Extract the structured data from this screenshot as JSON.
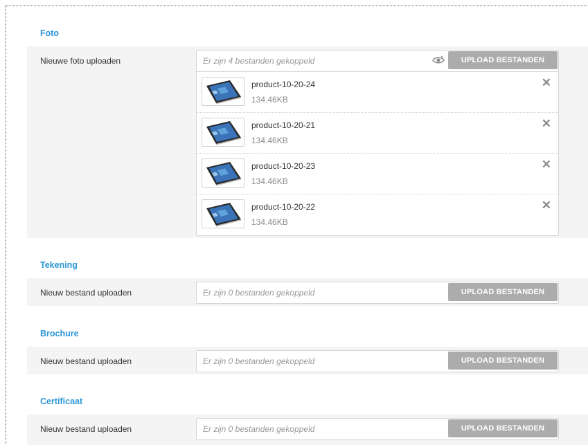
{
  "sections": {
    "foto": {
      "title": "Foto",
      "label": "Nieuwe foto uploaden",
      "placeholder": "Er zijn 4 bestanden gekoppeld",
      "button": "UPLOAD BESTANDEN",
      "files": [
        {
          "name": "product-10-20-24",
          "size": "134.46KB"
        },
        {
          "name": "product-10-20-21",
          "size": "134.46KB"
        },
        {
          "name": "product-10-20-23",
          "size": "134.46KB"
        },
        {
          "name": "product-10-20-22",
          "size": "134.46KB"
        }
      ]
    },
    "tekening": {
      "title": "Tekening",
      "label": "Nieuw bestand uploaden",
      "placeholder": "Er zijn 0 bestanden gekoppeld",
      "button": "UPLOAD BESTANDEN"
    },
    "brochure": {
      "title": "Brochure",
      "label": "Nieuw bestand uploaden",
      "placeholder": "Er zijn 0 bestanden gekoppeld",
      "button": "UPLOAD BESTANDEN"
    },
    "certificaat": {
      "title": "Certificaat",
      "label": "Nieuw bestand uploaden",
      "placeholder": "Er zijn 0 bestanden gekoppeld",
      "button": "UPLOAD BESTANDEN"
    }
  },
  "icons": {
    "preview": "eye-icon",
    "remove": "close-icon",
    "thumbnail": "tablet-thumbnail-icon"
  },
  "colors": {
    "section_title": "#2b96d6",
    "button": "#acacac",
    "row_background": "#f4f4f4"
  }
}
